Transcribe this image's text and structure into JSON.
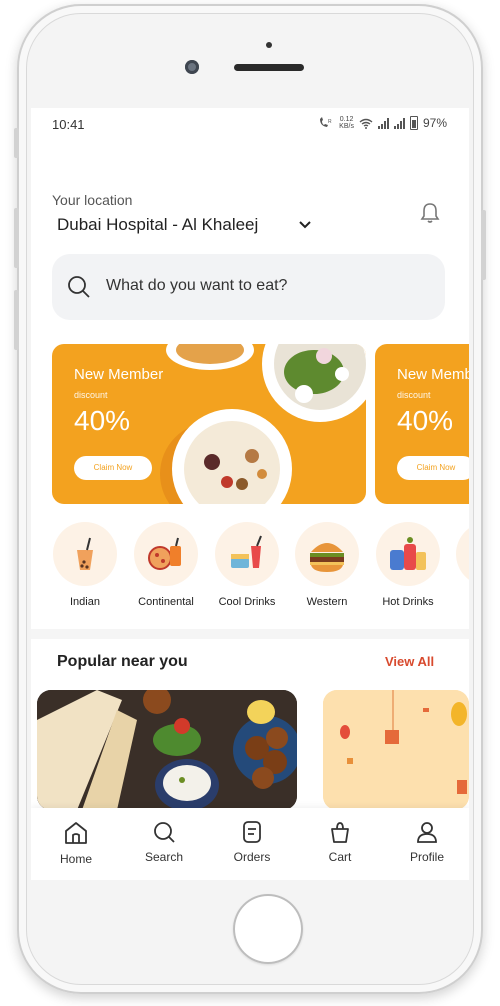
{
  "status": {
    "time": "10:41",
    "speed_top": "0.12",
    "speed_bottom": "KB/s",
    "battery": "97%"
  },
  "location": {
    "label": "Your location",
    "value": "Dubai Hospital - Al Khaleej"
  },
  "search": {
    "placeholder": "What do you want to eat?"
  },
  "banners": [
    {
      "title": "New Member",
      "subtitle": "discount",
      "percent": "40%",
      "button": "Claim Now"
    },
    {
      "title": "New Memb",
      "subtitle": "discount",
      "percent": "40%",
      "button": "Claim Now"
    }
  ],
  "categories": [
    {
      "label": "Indian",
      "icon": "bubble-tea-icon"
    },
    {
      "label": "Continental",
      "icon": "pizza-drink-icon"
    },
    {
      "label": "Cool Drinks",
      "icon": "cool-drinks-icon"
    },
    {
      "label": "Western",
      "icon": "burger-icon"
    },
    {
      "label": "Hot Drinks",
      "icon": "hot-drinks-icon"
    }
  ],
  "popular": {
    "title": "Popular near you",
    "view_all": "View All"
  },
  "tabs": [
    {
      "label": "Home",
      "icon": "home-icon"
    },
    {
      "label": "Search",
      "icon": "search-icon"
    },
    {
      "label": "Orders",
      "icon": "orders-icon"
    },
    {
      "label": "Cart",
      "icon": "cart-icon"
    },
    {
      "label": "Profile",
      "icon": "profile-icon"
    }
  ],
  "colors": {
    "accent": "#f3a21f",
    "view_all": "#d84a2e",
    "search_bg": "#f2f3f5"
  }
}
